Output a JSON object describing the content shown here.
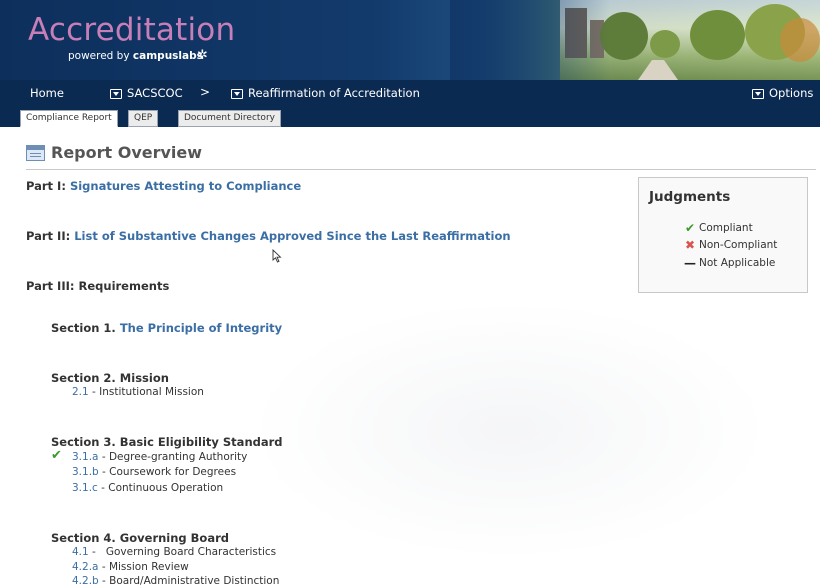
{
  "header": {
    "logo_title": "Accreditation",
    "logo_powered": "powered by",
    "logo_brand": "campuslabs",
    "logo_mark": "✲"
  },
  "nav": {
    "home": "Home",
    "dd1": "SACSCOC",
    "separator": ">",
    "dd2": "Reaffirmation of Accreditation",
    "options": "Options"
  },
  "tabs": [
    "Compliance Report",
    "QEP",
    "Document Directory"
  ],
  "overview": {
    "title": "Report Overview"
  },
  "parts": {
    "p1_label": "Part I:",
    "p1_link": "Signatures Attesting to Compliance",
    "p2_label": "Part II:",
    "p2_link": "List of Substantive Changes Approved Since the Last Reaffirmation",
    "p3_label": "Part III: Requirements"
  },
  "sections": {
    "s1_label": "Section 1.",
    "s1_link": "The Principle of Integrity",
    "s2": "Section 2. Mission",
    "s2_items": [
      {
        "code": "2.1",
        "text": " - Institutional Mission"
      }
    ],
    "s3": "Section 3. Basic Eligibility Standard",
    "s3_items": [
      {
        "code": "3.1.a",
        "text": " - Degree-granting Authority"
      },
      {
        "code": "3.1.b",
        "text": " - Coursework for Degrees"
      },
      {
        "code": "3.1.c",
        "text": " - Continuous Operation"
      }
    ],
    "s4": "Section 4. Governing Board",
    "s4_items": [
      {
        "code": "4.1",
        "text": " -   Governing Board Characteristics"
      },
      {
        "code": "4.2.a",
        "text": " - Mission Review"
      },
      {
        "code": "4.2.b",
        "text": " - Board/Administrative Distinction"
      }
    ]
  },
  "judgments": {
    "title": "Judgments",
    "compliant": "Compliant",
    "noncompliant": "Non-Compliant",
    "na": "Not Applicable"
  },
  "icons": {
    "compliant": "check-icon",
    "noncompliant": "x-icon",
    "na": "dash-icon"
  },
  "colors": {
    "nav_bg": "#0b2a52",
    "link": "#3a6ea5",
    "logo": "#c77fb8",
    "compliant": "#3a9a2a",
    "noncompliant": "#d9534f"
  }
}
